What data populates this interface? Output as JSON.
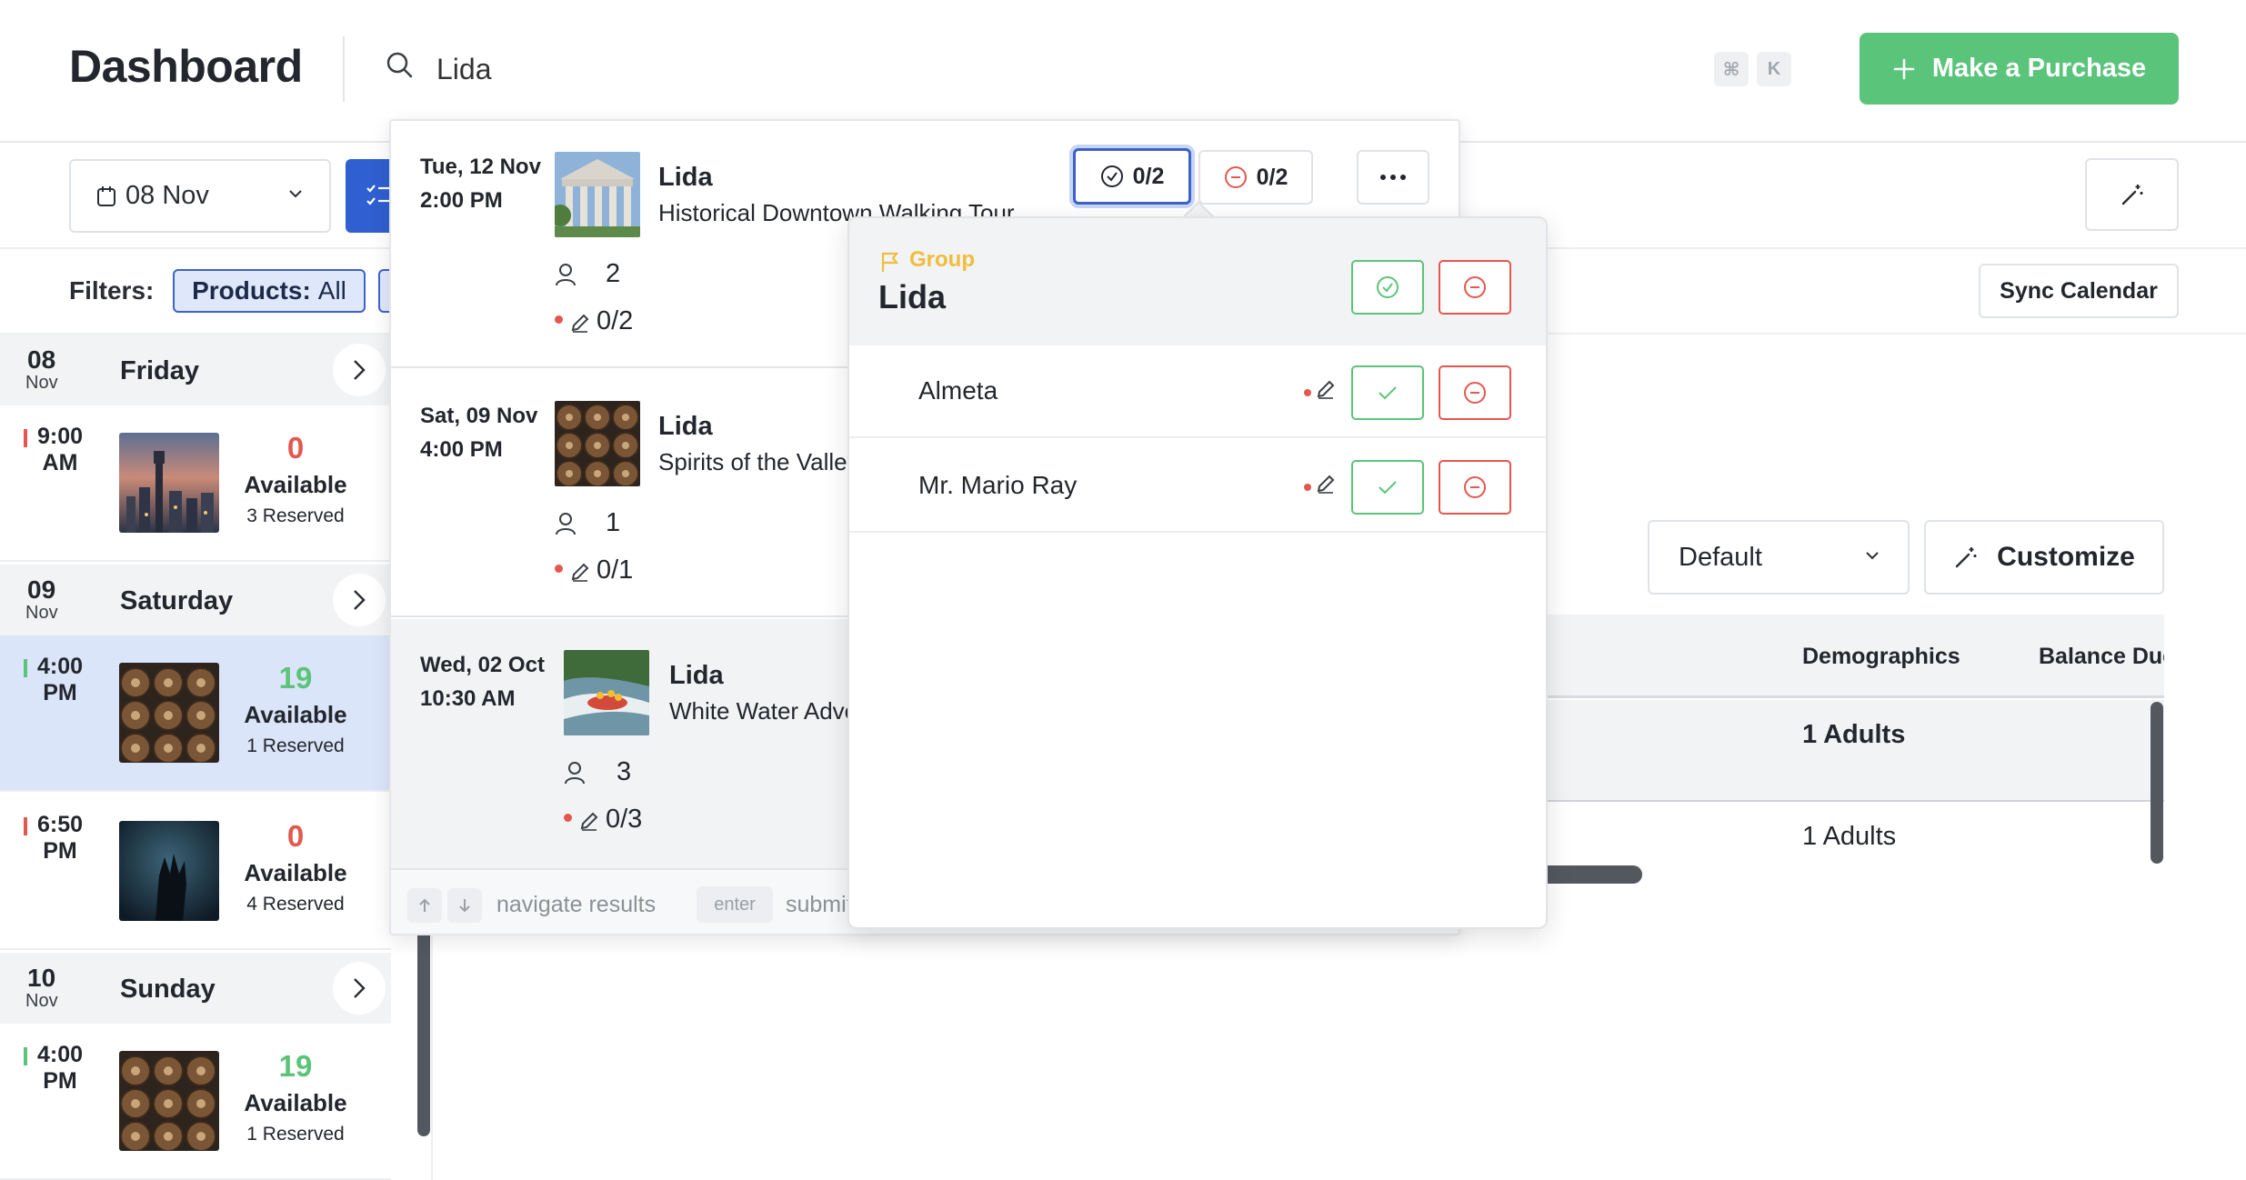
{
  "header": {
    "title": "Dashboard",
    "search_value": "Lida",
    "kbd_cmd": "⌘",
    "kbd_k": "K",
    "purchase_label": "Make a Purchase"
  },
  "toolbar": {
    "date": "08 Nov",
    "filters_label": "Filters:",
    "products_key": "Products:",
    "products_value": "All",
    "sync_label": "Sync Calendar"
  },
  "days": [
    {
      "num": "08",
      "mon": "Nov",
      "name": "Friday",
      "slots": [
        {
          "time": "9:00 AM",
          "count": "0",
          "available": "Available",
          "reserved": "3 Reserved"
        }
      ]
    },
    {
      "num": "09",
      "mon": "Nov",
      "name": "Saturday",
      "slots": [
        {
          "time": "4:00 PM",
          "count": "19",
          "available": "Available",
          "reserved": "1 Reserved"
        },
        {
          "time": "6:50 PM",
          "count": "0",
          "available": "Available",
          "reserved": "4 Reserved"
        }
      ]
    },
    {
      "num": "10",
      "mon": "Nov",
      "name": "Sunday",
      "slots": [
        {
          "time": "4:00 PM",
          "count": "19",
          "available": "Available",
          "reserved": "1 Reserved"
        }
      ]
    }
  ],
  "content": {
    "view_select": "Default",
    "customize_label": "Customize",
    "columns": [
      "Demographics",
      "Balance Due"
    ],
    "rows": [
      {
        "demographics": "1 Adults"
      },
      {
        "demographics": "1 Adults"
      }
    ]
  },
  "search_results": [
    {
      "date": "Tue, 12 Nov",
      "time": "2:00 PM",
      "name": "Lida",
      "product": "Historical Downtown Walking Tour",
      "guests": "2",
      "waivers": "0/2",
      "checked_in": "0/2",
      "no_show": "0/2"
    },
    {
      "date": "Sat, 09 Nov",
      "time": "4:00 PM",
      "name": "Lida",
      "product": "Spirits of the Valley",
      "guests": "1",
      "waivers": "0/1"
    },
    {
      "date": "Wed, 02 Oct",
      "time": "10:30 AM",
      "name": "Lida",
      "product": "White Water Adventure",
      "guests": "3",
      "waivers": "0/3"
    }
  ],
  "dropdown_footer": {
    "navigate": "navigate results",
    "enter_key": "enter",
    "submit": "submit"
  },
  "group_popover": {
    "kind": "Group",
    "name": "Lida",
    "members": [
      {
        "name": "Almeta"
      },
      {
        "name": "Mr. Mario Ray"
      }
    ]
  },
  "colors": {
    "accent_blue": "#2f5fd0",
    "success_green": "#5ac47b",
    "danger_red": "#e4574e",
    "group_yellow": "#f0bd3c"
  }
}
